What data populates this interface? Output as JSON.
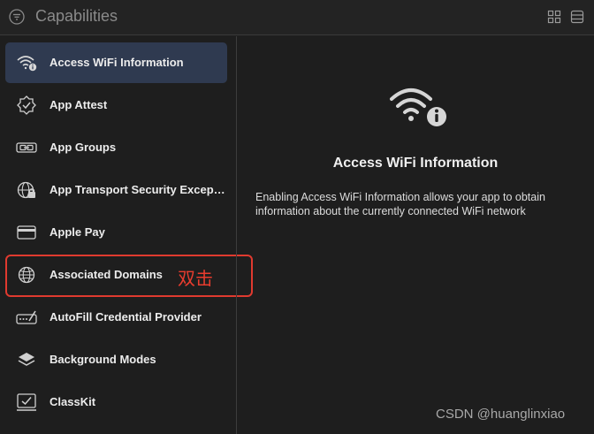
{
  "header": {
    "title": "Capabilities",
    "filter_icon": "filter-icon",
    "view_icons": [
      "grid-icon",
      "list-icon"
    ]
  },
  "sidebar": {
    "items": [
      {
        "label": "Access WiFi Information",
        "icon": "wifi-info-icon",
        "selected": true
      },
      {
        "label": "App Attest",
        "icon": "attest-badge-icon"
      },
      {
        "label": "App Groups",
        "icon": "app-groups-icon"
      },
      {
        "label": "App Transport Security Excepti...",
        "icon": "globe-lock-icon"
      },
      {
        "label": "Apple Pay",
        "icon": "card-icon"
      },
      {
        "label": "Associated Domains",
        "icon": "globe-icon"
      },
      {
        "label": "AutoFill Credential Provider",
        "icon": "password-field-icon"
      },
      {
        "label": "Background Modes",
        "icon": "layers-icon"
      },
      {
        "label": "ClassKit",
        "icon": "checkbox-screen-icon"
      }
    ]
  },
  "annotation": {
    "text": "双击",
    "color": "#e03a2f"
  },
  "detail": {
    "title": "Access WiFi Information",
    "description": "Enabling Access WiFi Information allows your app to obtain information about the currently connected WiFi network",
    "icon": "wifi-info-icon"
  },
  "watermark": "CSDN @huanglinxiao",
  "colors": {
    "background": "#1e1e1e",
    "selected": "#2f3a50",
    "highlight_border": "#e03a2f"
  }
}
